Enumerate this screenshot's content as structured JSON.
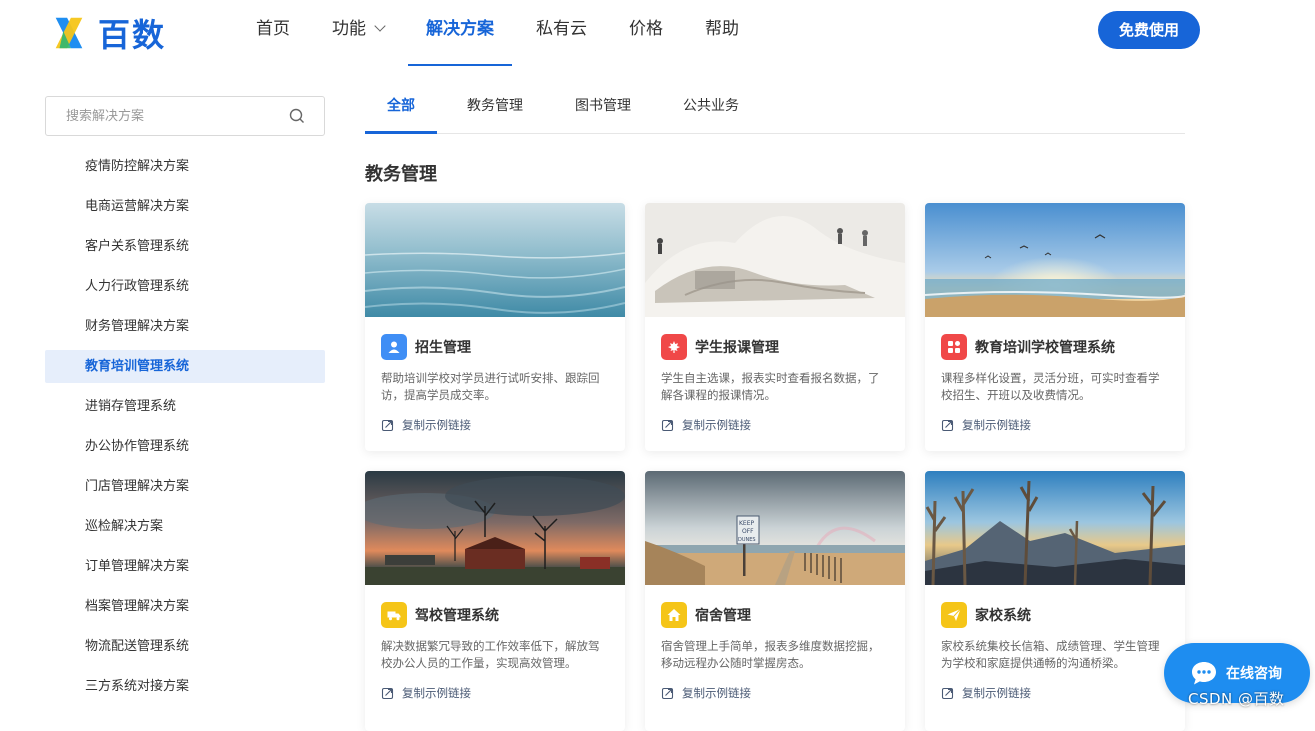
{
  "brand": {
    "name": "百数",
    "primary_color": "#1765d8"
  },
  "nav": {
    "items": [
      {
        "label": "首页"
      },
      {
        "label": "功能"
      },
      {
        "label": "解决方案"
      },
      {
        "label": "私有云"
      },
      {
        "label": "价格"
      },
      {
        "label": "帮助"
      }
    ],
    "active_index": 2,
    "cta_label": "免费使用"
  },
  "sidebar": {
    "search_placeholder": "搜索解决方案",
    "items": [
      {
        "label": "疫情防控解决方案"
      },
      {
        "label": "电商运营解决方案"
      },
      {
        "label": "客户关系管理系统"
      },
      {
        "label": "人力行政管理系统"
      },
      {
        "label": "财务管理解决方案"
      },
      {
        "label": "教育培训管理系统"
      },
      {
        "label": "进销存管理系统"
      },
      {
        "label": "办公协作管理系统"
      },
      {
        "label": "门店管理解决方案"
      },
      {
        "label": "巡检解决方案"
      },
      {
        "label": "订单管理解决方案"
      },
      {
        "label": "档案管理解决方案"
      },
      {
        "label": "物流配送管理系统"
      },
      {
        "label": "三方系统对接方案"
      }
    ],
    "active_index": 5
  },
  "tabs": {
    "items": [
      {
        "label": "全部"
      },
      {
        "label": "教务管理"
      },
      {
        "label": "图书管理"
      },
      {
        "label": "公共业务"
      }
    ],
    "active_index": 0
  },
  "section": {
    "title": "教务管理"
  },
  "cards": [
    {
      "title": "招生管理",
      "desc": "帮助培训学校对学员进行试听安排、跟踪回访，提高学员成交率。",
      "link": "复制示例链接",
      "icon": "person-icon",
      "icon_color": "#3f8ef5",
      "image": "sea-waves"
    },
    {
      "title": "学生报课管理",
      "desc": "学生自主选课，报表实时查看报名数据，了解各课程的报课情况。",
      "link": "复制示例链接",
      "icon": "maple-leaf-icon",
      "icon_color": "#f04848",
      "image": "white-architecture"
    },
    {
      "title": "教育培训学校管理系统",
      "desc": "课程多样化设置，灵活分班，可实时查看学校招生、开班以及收费情况。",
      "link": "复制示例链接",
      "icon": "grid-icon",
      "icon_color": "#f04848",
      "image": "beach-birds"
    },
    {
      "title": "驾校管理系统",
      "desc": "解决数据繁冗导致的工作效率低下，解放驾校办公人员的工作量，实现高效管理。",
      "link": "复制示例链接",
      "icon": "truck-icon",
      "icon_color": "#f5c518",
      "image": "sunset-farm"
    },
    {
      "title": "宿舍管理",
      "desc": "宿舍管理上手简单，报表多维度数据挖掘，移动远程办公随时掌握房态。",
      "link": "复制示例链接",
      "icon": "home-icon",
      "icon_color": "#f5c518",
      "image": "beach-sign"
    },
    {
      "title": "家校系统",
      "desc": "家校系统集校长信箱、成绩管理、学生管理为学校和家庭提供通畅的沟通桥梁。",
      "link": "复制示例链接",
      "icon": "paper-plane-icon",
      "icon_color": "#f5c518",
      "image": "mountain-trees"
    }
  ],
  "chat": {
    "label": "在线咨询"
  },
  "watermark": "CSDN @百数"
}
